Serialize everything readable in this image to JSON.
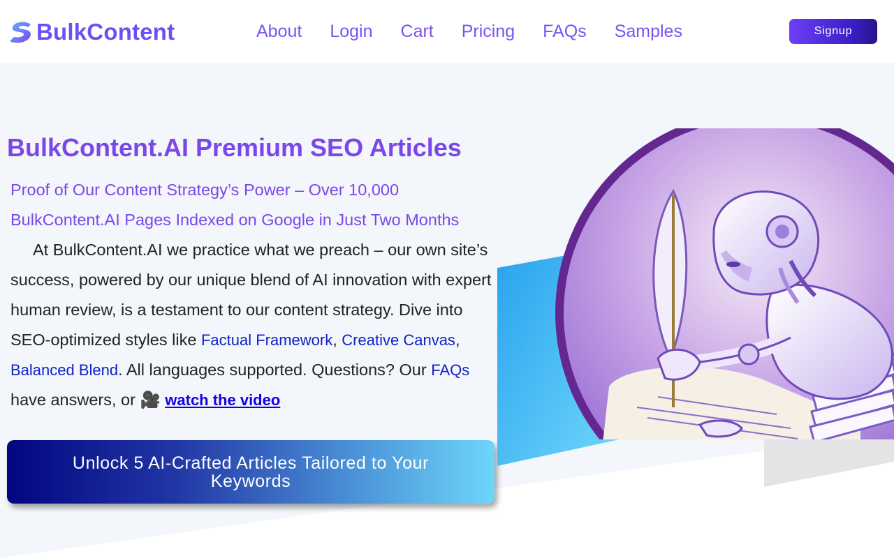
{
  "header": {
    "logo_text": "BulkContent",
    "nav": [
      "About",
      "Login",
      "Cart",
      "Pricing",
      "FAQs",
      "Samples"
    ],
    "signup_label": "Signup"
  },
  "hero": {
    "title": "BulkContent.AI Premium SEO Articles",
    "subtitle": "Proof of Our Content Strategy’s Power – Over 10,000 BulkContent.AI Pages Indexed on Google in Just Two Months",
    "body_1": "At BulkContent.AI we practice what we preach – our own site’s success, powered by our unique blend of AI innovation with expert human review, is a testament to our content strategy. Dive into SEO-optimized styles like ",
    "link_factual": "Factual Framework",
    "sep_1": ", ",
    "link_creative": "Creative Canvas",
    "sep_2": ", ",
    "link_balanced": "Balanced Blend",
    "body_2": ". All languages supported. Questions? Our ",
    "link_faqs": "FAQs",
    "body_3": " have answers, or 🎥 ",
    "link_video": "watch the video",
    "cta_label": "Unlock 5 AI-Crafted Articles Tailored to Your Keywords"
  },
  "colors": {
    "brand_purple": "#6f4ef6",
    "heading_purple": "#7a48ea",
    "link_blue": "#1020c8",
    "cta_start": "#02067f",
    "cta_end": "#6dd6fa"
  },
  "icons": {
    "logo": "logo-s-mark-icon",
    "video": "video-camera-icon"
  }
}
